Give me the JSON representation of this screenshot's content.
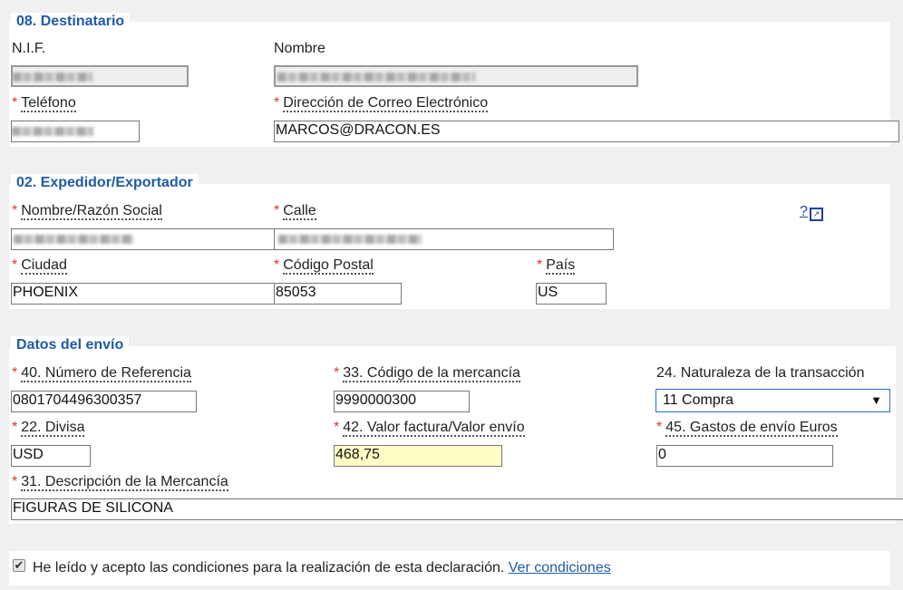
{
  "destinatario": {
    "legend": "08. Destinatario",
    "nif_label": "N.I.F.",
    "nombre_label": "Nombre",
    "telefono_label": "Teléfono",
    "email_label": "Dirección de Correo Electrónico",
    "email_value": "MARCOS@DRACON.ES"
  },
  "expedidor": {
    "legend": "02. Expedidor/Exportador",
    "nombre_label": "Nombre/Razón Social",
    "calle_label": "Calle",
    "ciudad_label": "Ciudad",
    "ciudad_value": "PHOENIX",
    "cp_label": "Código Postal",
    "cp_value": "85053",
    "pais_label": "País",
    "pais_value": "US",
    "help_text": "?"
  },
  "envio": {
    "legend": "Datos del envío",
    "ref_label": "40. Número de Referencia",
    "ref_value": "0801704496300357",
    "codigo_label": "33. Código de la mercancía",
    "codigo_value": "9990000300",
    "naturaleza_label": "24. Naturaleza de la transacción",
    "naturaleza_value": "11 Compra",
    "divisa_label": "22. Divisa",
    "divisa_value": "USD",
    "valor_label": "42. Valor factura/Valor envío",
    "valor_value": "468,75",
    "gastos_label": "45. Gastos de envío Euros",
    "gastos_value": "0",
    "descripcion_label": "31. Descripción de la Mercancía",
    "descripcion_value": "FIGURAS DE SILICONA"
  },
  "acepto": {
    "checkbox_mark": "✔",
    "text": "He leído y acepto las condiciones para la realización de esta declaración.",
    "link": "Ver condiciones"
  },
  "required_mark": "*",
  "colors": {
    "legend": "#1f5ba8",
    "required": "#dd3333",
    "highlight_input": "#ffffc4"
  }
}
